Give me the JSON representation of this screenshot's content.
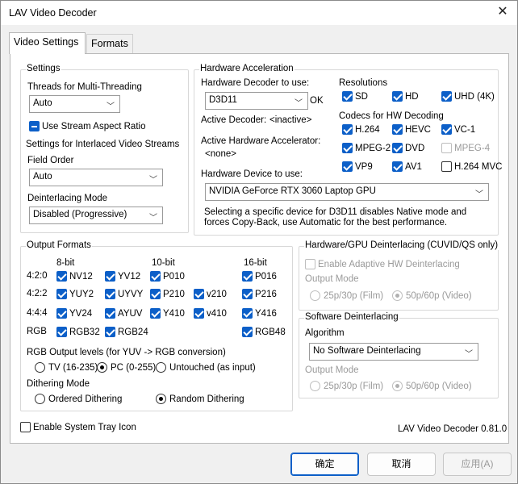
{
  "window": {
    "title": "LAV Video Decoder",
    "close_glyph": "✕"
  },
  "tabs": [
    {
      "label": "Video Settings",
      "active": true
    },
    {
      "label": "Formats",
      "active": false
    }
  ],
  "settings": {
    "title": "Settings",
    "threads_label": "Threads for Multi-Threading",
    "threads_value": "Auto",
    "stream_aspect_label": "Use Stream Aspect Ratio",
    "interlaced_label": "Settings for Interlaced Video Streams",
    "field_order_label": "Field Order",
    "field_order_value": "Auto",
    "deint_mode_label": "Deinterlacing Mode",
    "deint_mode_value": "Disabled (Progressive)"
  },
  "hwaccel": {
    "title": "Hardware Acceleration",
    "decoder_label": "Hardware Decoder to use:",
    "decoder_value": "D3D11",
    "decoder_status": "OK",
    "active_decoder_label": "Active Decoder:",
    "active_decoder_value": "<inactive>",
    "active_accel_label": "Active Hardware Accelerator:",
    "active_accel_value": "<none>",
    "device_label": "Hardware Device to use:",
    "device_value": "NVIDIA GeForce RTX 3060 Laptop GPU",
    "note": "Selecting a specific device for D3D11 disables Native mode and forces Copy-Back, use Automatic for the best performance.",
    "resolutions_label": "Resolutions",
    "res_sd": "SD",
    "res_hd": "HD",
    "res_uhd": "UHD (4K)",
    "codecs_label": "Codecs for HW Decoding",
    "codec_h264": "H.264",
    "codec_hevc": "HEVC",
    "codec_vc1": "VC-1",
    "codec_mpeg2": "MPEG-2",
    "codec_dvd": "DVD",
    "codec_mpeg4": "MPEG-4",
    "codec_vp9": "VP9",
    "codec_av1": "AV1",
    "codec_h264mvc": "H.264 MVC"
  },
  "output": {
    "title": "Output Formats",
    "col_8bit": "8-bit",
    "col_10bit": "10-bit",
    "col_16bit": "16-bit",
    "row_420": "4:2:0",
    "row_422": "4:2:2",
    "row_444": "4:4:4",
    "row_rgb": "RGB",
    "nv12": "NV12",
    "yv12": "YV12",
    "p010": "P010",
    "p016": "P016",
    "yuy2": "YUY2",
    "uyvy": "UYVY",
    "p210": "P210",
    "v210": "v210",
    "p216": "P216",
    "yv24": "YV24",
    "ayuv": "AYUV",
    "y410": "Y410",
    "v410": "v410",
    "y416": "Y416",
    "rgb32": "RGB32",
    "rgb24": "RGB24",
    "rgb48": "RGB48",
    "levels_label": "RGB Output levels (for YUV -> RGB conversion)",
    "level_tv": "TV (16-235)",
    "level_pc": "PC (0-255)",
    "level_untouched": "Untouched (as input)",
    "dither_label": "Dithering Mode",
    "dither_ordered": "Ordered Dithering",
    "dither_random": "Random Dithering"
  },
  "hwdeint": {
    "title": "Hardware/GPU Deinterlacing (CUVID/QS only)",
    "enable_label": "Enable Adaptive HW Deinterlacing",
    "output_mode_label": "Output Mode",
    "opt_film": "25p/30p (Film)",
    "opt_video": "50p/60p (Video)"
  },
  "swdeint": {
    "title": "Software Deinterlacing",
    "algorithm_label": "Algorithm",
    "algorithm_value": "No Software Deinterlacing",
    "output_mode_label": "Output Mode",
    "opt_film": "25p/30p (Film)",
    "opt_video": "50p/60p (Video)"
  },
  "footer": {
    "tray_label": "Enable System Tray Icon",
    "version": "LAV Video Decoder 0.81.0"
  },
  "buttons": {
    "ok": "确定",
    "cancel": "取消",
    "apply": "应用(A)"
  },
  "colors": {
    "accent": "#0c5fc8",
    "disabled_text": "#9a9a9a"
  }
}
